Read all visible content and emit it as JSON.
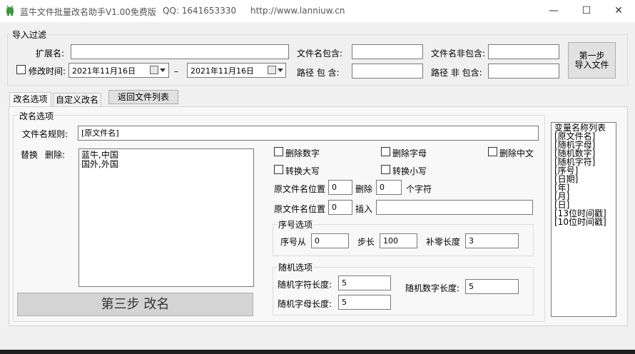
{
  "window": {
    "title": "蓝牛文件批量改名助手V1.00免费版",
    "qq": "QQ:  1641653330",
    "url": "http://www.lanniuw.cn",
    "minimize": "—",
    "maximize": "☐",
    "close": "✕"
  },
  "import_filter": {
    "group_label": "导入过滤",
    "ext_label": "扩展名:",
    "ext_value": "",
    "name_contains_label": "文件名包含:",
    "name_contains_value": "",
    "name_excludes_label": "文件名非包含:",
    "name_excludes_value": "",
    "modified_label": "修改时间:",
    "modified_checked": false,
    "date_from": "2021年11月16日",
    "date_sep": "–",
    "date_to": "2021年11月16日",
    "path_contains_label": "路径 包 含:",
    "path_contains_value": "",
    "path_excludes_label": "路径 非 包含:",
    "path_excludes_value": "",
    "step1_line1": "第一步",
    "step1_line2": "导入文件"
  },
  "tabs": [
    {
      "label": "改名选项",
      "active": true
    },
    {
      "label": "自定义改名",
      "active": false
    }
  ],
  "return_button": "返回文件列表",
  "rename": {
    "group_label": "改名选项",
    "rule_label": "文件名规则:",
    "rule_value": "[原文件名]",
    "replace_label": "替换",
    "delete_label": "删除:",
    "replace_text": "蓝牛,中国\n国外,外国",
    "checks": {
      "del_digits": "删除数字",
      "del_letters": "删除字母",
      "del_chinese": "删除中文",
      "to_upper": "转换大写",
      "to_lower": "转换小写"
    },
    "pos_label_1": "原文件名位置",
    "pos_value_1": "0",
    "delete_word": "删除",
    "delete_count": "0",
    "chars_label": "个字符",
    "pos_label_2": "原文件名位置",
    "pos_value_2": "0",
    "insert_label": "插入",
    "insert_value": "",
    "seq_group": "序号选项",
    "seq_from_label": "序号从",
    "seq_from_value": "0",
    "step_label": "步长",
    "step_value": "100",
    "pad_label": "补零长度",
    "pad_value": "3",
    "rand_group": "随机选项",
    "rand_char_label": "随机字符长度:",
    "rand_char_value": "5",
    "rand_digit_label": "随机数字长度:",
    "rand_digit_value": "5",
    "rand_letter_label": "随机字母长度:",
    "rand_letter_value": "5",
    "step3_label": "第三步  改名"
  },
  "variables": [
    "变量名称列表",
    "[原文件名]",
    "[随机字母]",
    "[随机数字]",
    "[随机字符]",
    "[序号]",
    "[日期]",
    "[年]",
    "[月]",
    "[日]",
    "[13位时间戳]",
    "[10位时间戳]"
  ],
  "colors": {
    "accent_green": "#3c9a3c",
    "window_bg": "#f0f0f0"
  }
}
